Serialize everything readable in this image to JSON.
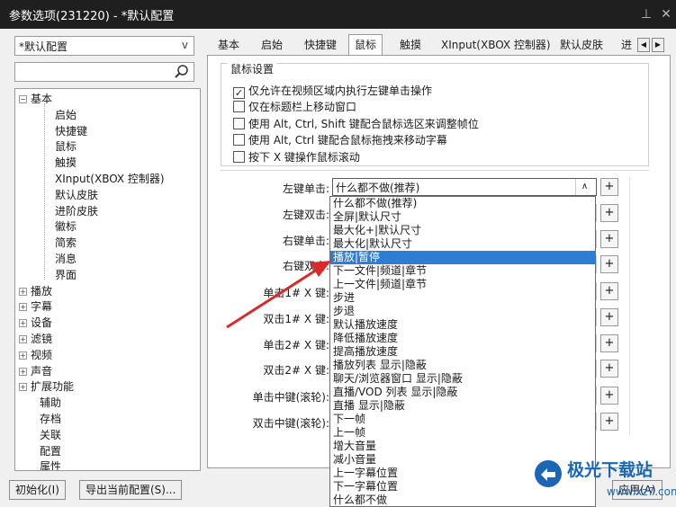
{
  "window": {
    "title": "参数选项(231220) - *默认配置",
    "pin_icon": "pin-icon",
    "close_icon": "close-icon"
  },
  "left": {
    "profile_combo": "*默认配置",
    "search_placeholder": "",
    "tree": {
      "basic": "基本",
      "basic_children": [
        "启始",
        "快捷键",
        "鼠标",
        "触摸",
        "XInput(XBOX 控制器)",
        "默认皮肤",
        "进阶皮肤",
        "徽标",
        "简索",
        "消息",
        "界面"
      ],
      "groups": [
        "播放",
        "字幕",
        "设备",
        "滤镜",
        "视频",
        "声音",
        "扩展功能"
      ],
      "leaves": [
        "辅助",
        "存档",
        "关联",
        "配置",
        "属性"
      ]
    }
  },
  "tabs": [
    "基本",
    "启始",
    "快捷键",
    "鼠标",
    "触摸",
    "XInput(XBOX 控制器)",
    "默认皮肤",
    "进"
  ],
  "active_tab": "鼠标",
  "mouse_settings": {
    "group_title": "鼠标设置",
    "options": [
      {
        "label": "仅允许在视频区域内执行左键单击操作",
        "checked": true
      },
      {
        "label": "仅在标题栏上移动窗口",
        "checked": false
      },
      {
        "label": "使用 Alt, Ctrl, Shift 键配合鼠标选区来调整帧位",
        "checked": false
      },
      {
        "label": "使用 Alt, Ctrl 键配合鼠标拖拽来移动字幕",
        "checked": false
      },
      {
        "label": "按下 X 键操作鼠标滚动",
        "checked": false
      }
    ],
    "rows": [
      "左键单击:",
      "左键双击:",
      "右键单击:",
      "右键双击:",
      "单击1# X 键:",
      "双击1# X 键:",
      "单击2# X 键:",
      "双击2# X 键:",
      "单击中键(滚轮):",
      "双击中键(滚轮):"
    ],
    "left_click_value": "什么都不做(推荐)"
  },
  "dropdown": {
    "items": [
      "什么都不做(推荐)",
      "全屏|默认尺寸",
      "最大化+|默认尺寸",
      "最大化|默认尺寸",
      "播放|暂停",
      "下一文件|频道|章节",
      "上一文件|频道|章节",
      "步进",
      "步退",
      "默认播放速度",
      "降低播放速度",
      "提高播放速度",
      "播放列表 显示|隐蔽",
      "聊天/浏览器窗口 显示|隐蔽",
      "直播/VOD 列表 显示|隐蔽",
      "直播 显示|隐蔽",
      "下一帧",
      "上一帧",
      "增大音量",
      "减小音量",
      "上一字幕位置",
      "下一字幕位置",
      "什么都不做"
    ],
    "selected_index": 4
  },
  "buttons": {
    "init": "初始化(I)",
    "export": "导出当前配置(S)...",
    "apply": "应用(A)"
  },
  "watermark": {
    "brand": "极光下载站",
    "url": "www.xz7.com"
  }
}
